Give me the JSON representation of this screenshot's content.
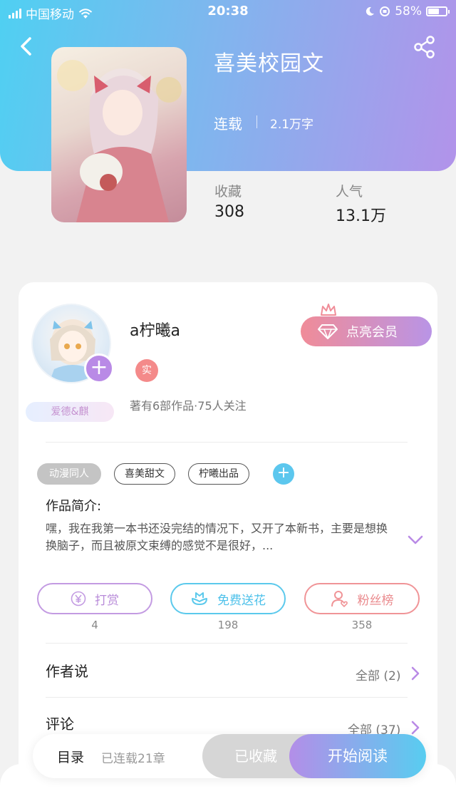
{
  "status_bar": {
    "carrier": "中国移动",
    "time": "20:38",
    "battery_text": "58%",
    "battery_level": 0.58
  },
  "book": {
    "title": "喜美校园文",
    "status": "连载",
    "word_count": "2.1万字",
    "stats": {
      "favorites_label": "收藏",
      "favorites_value": "308",
      "popularity_label": "人气",
      "popularity_value": "13.1万"
    }
  },
  "author": {
    "name": "a柠曦a",
    "real_badge": "实",
    "fan_badge": "爱德&麒",
    "meta": "著有6部作品·75人关注",
    "vip_button": "点亮会员"
  },
  "tags": [
    "动漫同人",
    "喜美甜文",
    "柠曦出品"
  ],
  "intro": {
    "title": "作品简介:",
    "text": "嘿，我在我第一本书还没完结的情况下，又开了本新书，主要是想换换脑子，而且被原文束缚的感觉不是很好，..."
  },
  "actions": [
    {
      "label": "打赏",
      "count": "4"
    },
    {
      "label": "免费送花",
      "count": "198"
    },
    {
      "label": "粉丝榜",
      "count": "358"
    }
  ],
  "author_says": {
    "title": "作者说",
    "link": "全部 (2)"
  },
  "comments": {
    "title": "评论",
    "link": "全部 (37)"
  },
  "bottom_bar": {
    "toc": "目录",
    "chapters": "已连载21章",
    "favorited": "已收藏",
    "start_reading": "开始阅读"
  },
  "colors": {
    "header_gradient_start": "#4fd0f2",
    "header_gradient_end": "#b293ea",
    "vip_gradient_start": "#f08c98",
    "vip_gradient_end": "#b994e6"
  }
}
